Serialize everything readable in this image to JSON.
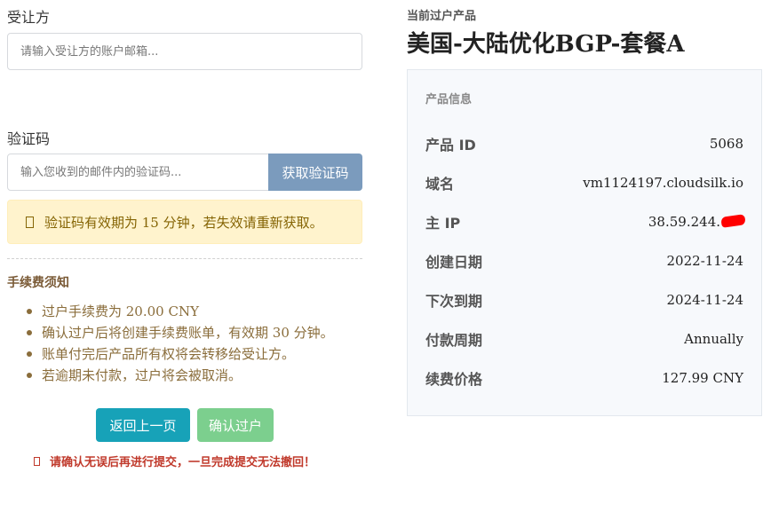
{
  "form": {
    "recipient_label": "受让方",
    "recipient_placeholder": "请输入受让方的账户邮箱...",
    "code_label": "验证码",
    "code_placeholder": "输入您收到的邮件内的验证码...",
    "get_code_button": "获取验证码",
    "code_notice": "验证码有效期为 15 分钟，若失效请重新获取。"
  },
  "fee": {
    "title": "手续费须知",
    "items": [
      "过户手续费为 20.00 CNY",
      "确认过户后将创建手续费账单，有效期 30 分钟。",
      "账单付完后产品所有权将会转移给受让方。",
      "若逾期未付款，过户将会被取消。"
    ]
  },
  "actions": {
    "back_label": "返回上一页",
    "confirm_label": "确认过户",
    "warning": "请确认无误后再进行提交，一旦完成提交无法撤回！"
  },
  "product": {
    "header": "当前过户产品",
    "name": "美国-大陆优化BGP-套餐A",
    "info_title": "产品信息",
    "rows": [
      {
        "key": "产品 ID",
        "value": "5068"
      },
      {
        "key": "域名",
        "value": "vm1124197.cloudsilk.io"
      },
      {
        "key": "主 IP",
        "value": "38.59.244."
      },
      {
        "key": "创建日期",
        "value": "2022-11-24"
      },
      {
        "key": "下次到期",
        "value": "2024-11-24"
      },
      {
        "key": "付款周期",
        "value": "Annually"
      },
      {
        "key": "续费价格",
        "value": "127.99 CNY"
      }
    ]
  },
  "colors": {
    "info_button": "#17a2b8",
    "success_button": "#7ccf8e",
    "code_button": "#7b9bbd",
    "alert_bg": "#fff3cd",
    "warning_text": "#c0392b",
    "redaction": "#ff0000"
  }
}
